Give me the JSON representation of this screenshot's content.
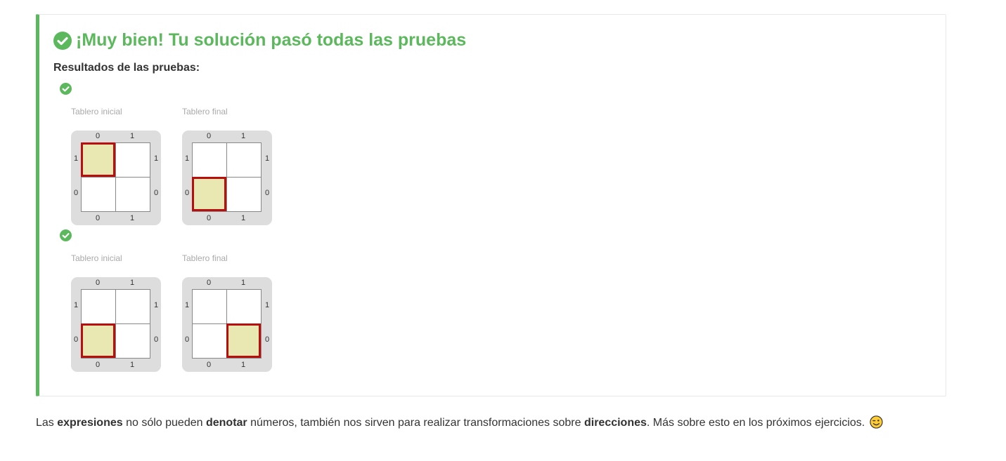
{
  "result": {
    "title": "¡Muy bien! Tu solución pasó todas las pruebas",
    "results_label": "Resultados de las pruebas:",
    "status_color": "#5cb85c"
  },
  "tests": [
    {
      "status": "passed",
      "initial_caption": "Tablero inicial",
      "final_caption": "Tablero final",
      "initial_board": {
        "columns": [
          "0",
          "1"
        ],
        "rows": [
          "1",
          "0"
        ],
        "head": {
          "x": 0,
          "y": 1
        }
      },
      "final_board": {
        "columns": [
          "0",
          "1"
        ],
        "rows": [
          "1",
          "0"
        ],
        "head": {
          "x": 0,
          "y": 0
        }
      }
    },
    {
      "status": "passed",
      "initial_caption": "Tablero inicial",
      "final_caption": "Tablero final",
      "initial_board": {
        "columns": [
          "0",
          "1"
        ],
        "rows": [
          "1",
          "0"
        ],
        "head": {
          "x": 0,
          "y": 0
        }
      },
      "final_board": {
        "columns": [
          "0",
          "1"
        ],
        "rows": [
          "1",
          "0"
        ],
        "head": {
          "x": 1,
          "y": 0
        }
      }
    }
  ],
  "footer": {
    "t1": "Las ",
    "b1": "expresiones",
    "t2": " no sólo pueden ",
    "b2": "denotar",
    "t3": " números, también nos sirven para realizar transformaciones sobre ",
    "b3": "direcciones",
    "t4": ". Más sobre esto en los próximos ejercicios.",
    "emoji": "wink-emoji-icon"
  },
  "colors": {
    "head_fill": "#eae8b2",
    "head_border": "#b80e0e",
    "board_bg": "#dddddd"
  }
}
